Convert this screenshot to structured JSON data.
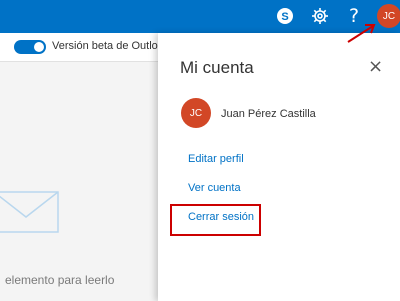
{
  "topbar": {
    "skype_icon": "skype-icon",
    "settings_icon": "gear-icon",
    "help_label": "?",
    "avatar_initials": "JC"
  },
  "left_pane": {
    "beta_toggle_label": "Versión beta de Outlook",
    "empty_message": "elemento para leerlo",
    "envelope_icon": "envelope-icon"
  },
  "account_panel": {
    "title": "Mi cuenta",
    "close_label": "×",
    "avatar_initials": "JC",
    "user_name": "Juan Pérez Castilla",
    "links": {
      "edit_profile": "Editar perfil",
      "view_account": "Ver cuenta",
      "sign_out": "Cerrar sesión"
    }
  },
  "colors": {
    "topbar": "#0072c6",
    "avatar": "#d24726",
    "link": "#0072c6",
    "annotation": "#cc0000"
  }
}
